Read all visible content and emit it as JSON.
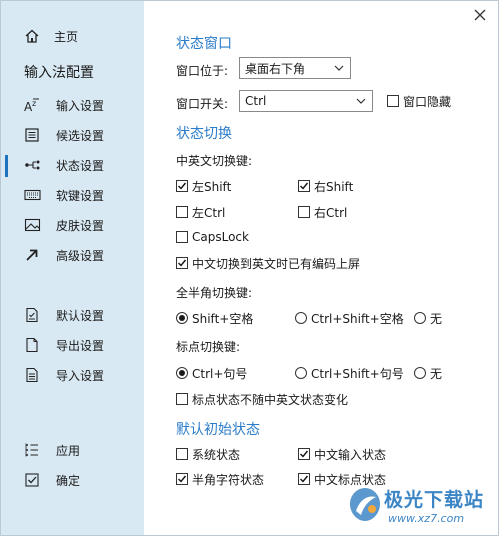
{
  "sidebar": {
    "home": "主页",
    "heading": "输入法配置",
    "items": [
      {
        "label": "输入设置",
        "icon": "font-size-icon"
      },
      {
        "label": "候选设置",
        "icon": "list-icon"
      },
      {
        "label": "状态设置",
        "icon": "flow-icon"
      },
      {
        "label": "软键设置",
        "icon": "keyboard-icon"
      },
      {
        "label": "皮肤设置",
        "icon": "image-icon"
      },
      {
        "label": "高级设置",
        "icon": "arrow-up-right-icon"
      }
    ],
    "actions": [
      {
        "label": "默认设置",
        "icon": "document-icon"
      },
      {
        "label": "导出设置",
        "icon": "file-icon"
      },
      {
        "label": "导入设置",
        "icon": "file-lines-icon"
      }
    ],
    "footer": [
      {
        "label": "应用",
        "icon": "checklist-icon"
      },
      {
        "label": "确定",
        "icon": "checkbox-icon"
      }
    ],
    "active_index": 2
  },
  "status_window": {
    "title": "状态窗口",
    "position_label": "窗口位于:",
    "position_value": "桌面右下角",
    "toggle_label": "窗口开关:",
    "toggle_value": "Ctrl",
    "hide_label": "窗口隐藏",
    "hide_checked": false
  },
  "status_switch": {
    "title": "状态切换",
    "cn_en_label": "中英文切换键:",
    "left_shift": "左Shift",
    "right_shift": "右Shift",
    "left_ctrl": "左Ctrl",
    "right_ctrl": "右Ctrl",
    "capslock": "CapsLock",
    "commit_on_switch": "中文切换到英文时已有编码上屏",
    "fullhalf_label": "全半角切换键:",
    "fullhalf_opt1": "Shift+空格",
    "fullhalf_opt2": "Ctrl+Shift+空格",
    "fullhalf_opt3": "无",
    "punct_label": "标点切换键:",
    "punct_opt1": "Ctrl+句号",
    "punct_opt2": "Ctrl+Shift+句号",
    "punct_opt3": "无",
    "punct_independent": "标点状态不随中英文状态变化"
  },
  "default_state": {
    "title": "默认初始状态",
    "system_state": "系统状态",
    "cn_input_state": "中文输入状态",
    "halfwidth_state": "半角字符状态",
    "cn_punct_state": "中文标点状态"
  },
  "watermark": {
    "title": "极光下载站",
    "url": "www.xz7.com"
  },
  "colors": {
    "sidebar_bg": "#d9e9f3",
    "accent": "#2b7cc9",
    "active_marker": "#1e73be"
  }
}
